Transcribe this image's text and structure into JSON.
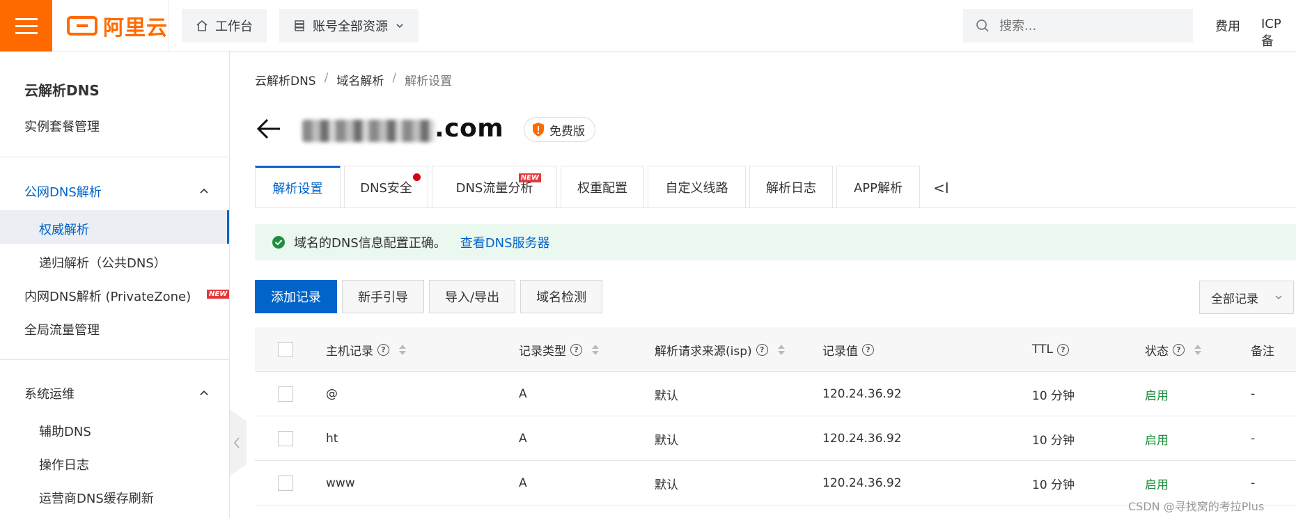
{
  "header": {
    "logo_text": "阿里云",
    "workbench_label": "工作台",
    "resources_label": "账号全部资源",
    "search_placeholder": "搜索...",
    "fees_label": "费用",
    "icp_label": "ICP 备"
  },
  "sidebar": {
    "title": "云解析DNS",
    "instance_mgmt": "实例套餐管理",
    "public_dns": "公网DNS解析",
    "authoritative": "权威解析",
    "recursive": "递归解析（公共DNS）",
    "private_dns": "内网DNS解析 (PrivateZone)",
    "new_tag": "NEW",
    "global_traffic": "全局流量管理",
    "ops": "系统运维",
    "aux_dns": "辅助DNS",
    "op_log": "操作日志",
    "isp_cache": "运营商DNS缓存刷新"
  },
  "breadcrumb": {
    "root": "云解析DNS",
    "domain_resolution": "域名解析",
    "current": "解析设置",
    "sep": "/"
  },
  "domain": {
    "name_suffix": ".com",
    "plan": "免费版"
  },
  "tabs": [
    {
      "label": "解析设置"
    },
    {
      "label": "DNS安全"
    },
    {
      "label": "DNS流量分析",
      "tag": "NEW"
    },
    {
      "label": "权重配置"
    },
    {
      "label": "自定义线路"
    },
    {
      "label": "解析日志"
    },
    {
      "label": "APP解析"
    }
  ],
  "tab_collapse": "<I",
  "notice": {
    "text": "域名的DNS信息配置正确。",
    "link": "查看DNS服务器"
  },
  "toolbar": {
    "add_record": "添加记录",
    "guide": "新手引导",
    "import_export": "导入/导出",
    "domain_check": "域名检测",
    "filter": "全部记录"
  },
  "table": {
    "headers": {
      "host": "主机记录",
      "type": "记录类型",
      "isp": "解析请求来源(isp)",
      "value": "记录值",
      "ttl": "TTL",
      "status": "状态",
      "remark": "备注"
    },
    "rows": [
      {
        "host": "@",
        "type": "A",
        "isp": "默认",
        "value": "120.24.36.92",
        "ttl": "10 分钟",
        "status": "启用",
        "remark": "-"
      },
      {
        "host": "ht",
        "type": "A",
        "isp": "默认",
        "value": "120.24.36.92",
        "ttl": "10 分钟",
        "status": "启用",
        "remark": "-"
      },
      {
        "host": "www",
        "type": "A",
        "isp": "默认",
        "value": "120.24.36.92",
        "ttl": "10 分钟",
        "status": "启用",
        "remark": "-"
      }
    ]
  },
  "watermark": "CSDN @寻找窝的考拉Plus",
  "colors": {
    "brand": "#ff6a00",
    "primary": "#0064c8",
    "success": "#1e8e3e",
    "badge_red": "#e4393c"
  }
}
